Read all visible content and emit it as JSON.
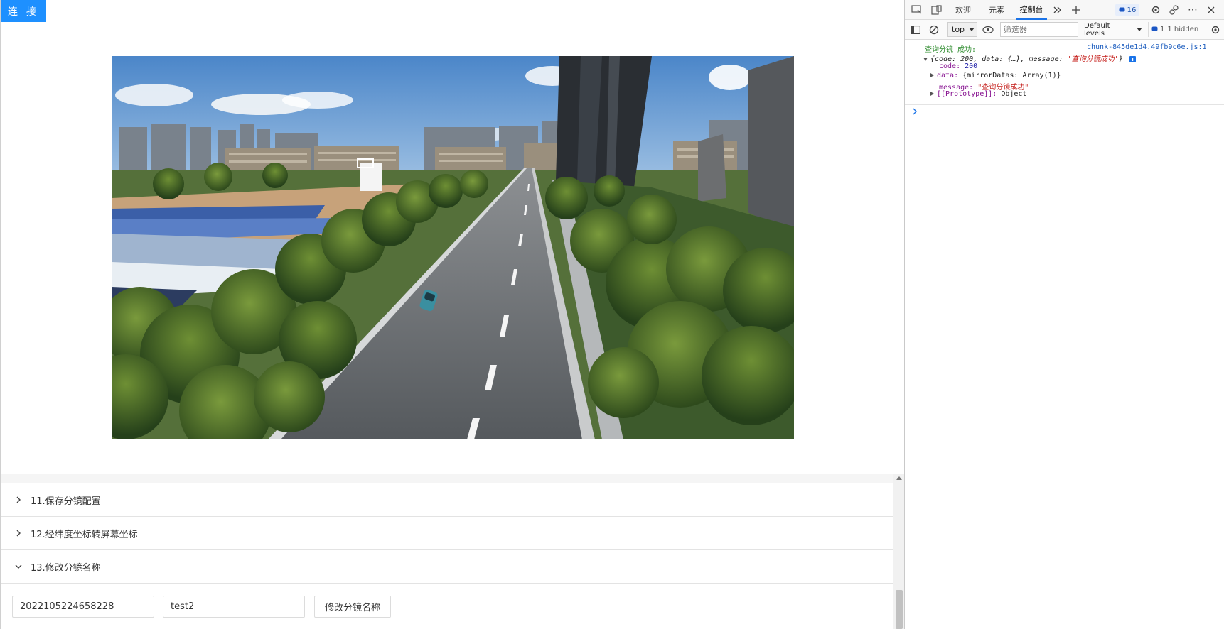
{
  "page": {
    "connect_label": "连 接",
    "accordion": [
      {
        "label": "11.保存分镜配置",
        "expanded": false
      },
      {
        "label": "12.经纬度坐标转屏幕坐标",
        "expanded": false
      },
      {
        "label": "13.修改分镜名称",
        "expanded": true
      }
    ],
    "form": {
      "id_value": "2022105224658228",
      "name_value": "test2",
      "submit_label": "修改分镜名称"
    }
  },
  "devtools": {
    "tabs": [
      "欢迎",
      "元素",
      "控制台"
    ],
    "active_tab": "控制台",
    "badge_count": "16",
    "context": "top",
    "filter_placeholder": "筛选器",
    "levels_label": "Default levels",
    "hidden_label": "1 hidden",
    "hidden_count": "1",
    "console": {
      "log_title": "查询分镜 成功:",
      "source_link": "chunk-845de1d4.49fb9c6e.js:1",
      "summary_prefix": "{code: 200, data: {…}, message: ",
      "summary_message": "'查询分镜成功'",
      "summary_suffix": "}",
      "code_key": "code:",
      "code_value": "200",
      "data_key": "data:",
      "data_value": "{mirrorDatas: Array(1)}",
      "message_key": "message:",
      "message_value": "\"查询分镜成功\"",
      "proto_key": "[[Prototype]]:",
      "proto_value": "Object"
    }
  },
  "colors": {
    "accent": "#1e90ff",
    "devtools_active": "#1a73e8",
    "log_green": "#2b8a2b"
  }
}
